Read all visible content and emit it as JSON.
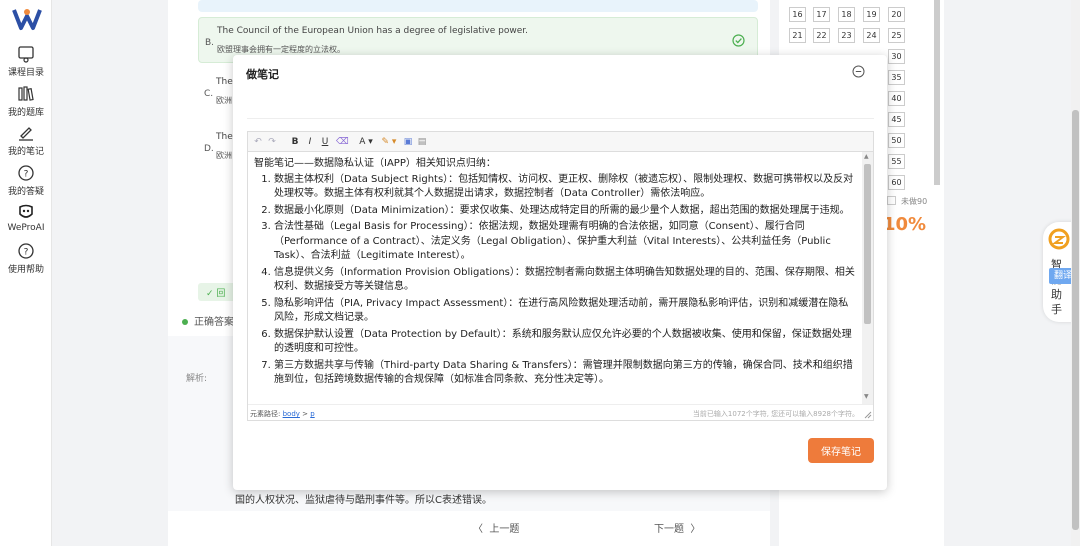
{
  "sidebar": {
    "items": [
      {
        "label": "课程目录",
        "icon": "course-catalog-icon"
      },
      {
        "label": "我的题库",
        "icon": "question-bank-icon"
      },
      {
        "label": "我的笔记",
        "icon": "pen-icon"
      },
      {
        "label": "我的答疑",
        "icon": "question-circle-icon"
      },
      {
        "label": "WeProAI",
        "icon": "ai-bot-icon"
      },
      {
        "label": "使用帮助",
        "icon": "help-icon"
      }
    ]
  },
  "question": {
    "options": [
      {
        "letter": "B.",
        "en": "The Council of the European Union has a degree of legislative power.",
        "zh": "欧盟理事会拥有一定程度的立法权。"
      },
      {
        "letter": "C.",
        "en": "The",
        "zh": "欧洲"
      },
      {
        "letter": "D.",
        "en": "The",
        "zh": "欧洲"
      }
    ],
    "summary_strip": "✓ 回",
    "correct_label": "正确答案",
    "explain_label": "解析:",
    "explain_tail": "国的人权状况、监狱虐待与酷刑事件等。所以C表述错误。",
    "prev_label": "上一题",
    "next_label": "下一题"
  },
  "answer_sheet": {
    "numbers": [
      "16",
      "17",
      "18",
      "19",
      "20",
      "21",
      "22",
      "23",
      "24",
      "25",
      "30",
      "35",
      "40",
      "45",
      "50",
      "55",
      "60"
    ],
    "legend_unanswered": "未做90",
    "percent": "10%"
  },
  "assistant": {
    "label": "智能助手",
    "translate_badge": "翻译"
  },
  "note_modal": {
    "title": "做笔记",
    "title_input_value": "",
    "toolbar": {
      "undo": "↶",
      "redo": "↷",
      "bold": "B",
      "italic": "I",
      "underline": "U",
      "eraser": "⌫",
      "font_color": "A ▾",
      "highlight": "✎ ▾",
      "image": "▣",
      "doc": "▤"
    },
    "editor": {
      "heading": "智能笔记——数据隐私认证（IAPP）相关知识点归纳：",
      "items": [
        "数据主体权利（Data Subject Rights）：包括知情权、访问权、更正权、删除权（被遗忘权）、限制处理权、数据可携带权以及反对处理权等。数据主体有权利就其个人数据提出请求，数据控制者（Data Controller）需依法响应。",
        "数据最小化原则（Data Minimization）：要求仅收集、处理达成特定目的所需的最少量个人数据，超出范围的数据处理属于违规。",
        "合法性基础（Legal Basis for Processing）：依据法规，数据处理需有明确的合法依据，如同意（Consent）、履行合同（Performance of a Contract）、法定义务（Legal Obligation）、保护重大利益（Vital Interests）、公共利益任务（Public Task）、合法利益（Legitimate Interest）。",
        "信息提供义务（Information Provision Obligations）：数据控制者需向数据主体明确告知数据处理的目的、范围、保存期限、相关权利、数据接受方等关键信息。",
        "隐私影响评估（PIA, Privacy Impact Assessment）：在进行高风险数据处理活动前，需开展隐私影响评估，识别和减缓潜在隐私风险，形成文档记录。",
        "数据保护默认设置（Data Protection by Default）：系统和服务默认应仅允许必要的个人数据被收集、使用和保留，保证数据处理的透明度和可控性。",
        "第三方数据共享与传输（Third-party Data Sharing & Transfers）：需管理并限制数据向第三方的传输，确保合同、技术和组织措施到位，包括跨境数据传输的合规保障（如标准合同条款、充分性决定等）。"
      ]
    },
    "status": {
      "path_label": "元素路径:",
      "path_body": "body",
      "path_sep": " > ",
      "path_p": "p",
      "count_text": "当前已输入1072个字符, 您还可以输入8928个字符。"
    },
    "save_button": "保存笔记"
  }
}
